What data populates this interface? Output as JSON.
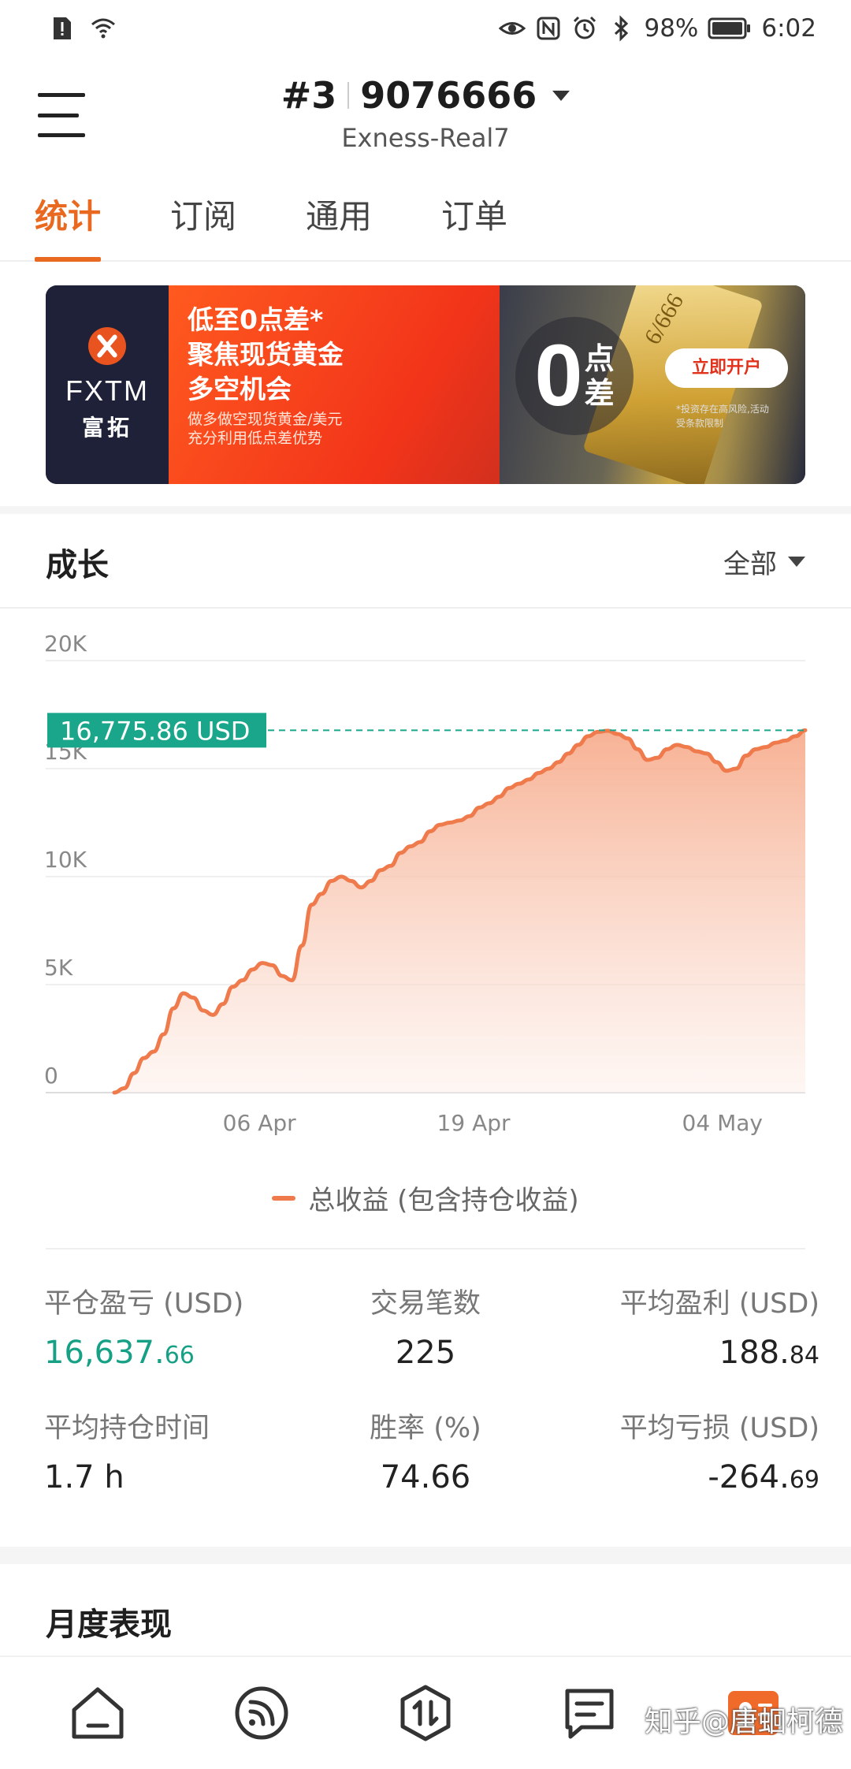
{
  "status_bar": {
    "battery": "98%",
    "time": "6:02"
  },
  "header": {
    "account_prefix": "#3",
    "account_number": "9076666",
    "server": "Exness-Real7"
  },
  "tabs": [
    {
      "label": "统计",
      "active": true
    },
    {
      "label": "订阅",
      "active": false
    },
    {
      "label": "通用",
      "active": false
    },
    {
      "label": "订单",
      "active": false
    }
  ],
  "banner": {
    "brand": "FXTM",
    "brand_cn": "富拓",
    "headline_1": "低至0点差*",
    "headline_2": "聚焦现货黄金",
    "headline_3": "多空机会",
    "sub_1": "做多做空现货黄金/美元",
    "sub_2": "充分利用低点差优势",
    "zero": "0",
    "zero_label_1": "点",
    "zero_label_2": "差",
    "gold_mark": "6/666",
    "cta": "立即开户",
    "disclaimer": "*投资存在高风险,活动受条款限制"
  },
  "growth": {
    "title": "成长",
    "range": "全部"
  },
  "chart_data": {
    "type": "area",
    "y_ticks": [
      "20K",
      "15K",
      "10K",
      "5K",
      "0"
    ],
    "x_ticks": [
      "06 Apr",
      "19 Apr",
      "04 May"
    ],
    "ylim": [
      0,
      20000
    ],
    "current_value_label": "16,775.86 USD",
    "current_value": 16775.86,
    "legend": "总收益 (包含持仓收益)",
    "colors": {
      "line": "#ef7a4c",
      "fill_top": "#f6a989",
      "fill_bottom": "#fdf1ec",
      "marker": "#1aa68a"
    },
    "values": [
      0,
      200,
      900,
      1600,
      1900,
      2700,
      3900,
      4600,
      4400,
      3800,
      3600,
      4100,
      4900,
      5200,
      5700,
      6000,
      5900,
      5400,
      5200,
      6800,
      8700,
      9200,
      9800,
      10000,
      9800,
      9500,
      9800,
      10300,
      10500,
      11100,
      11400,
      11600,
      12100,
      12400,
      12500,
      12600,
      12800,
      13200,
      13400,
      13700,
      14100,
      14300,
      14500,
      14800,
      15000,
      15300,
      15700,
      16100,
      16500,
      16700,
      16750,
      16600,
      16400,
      15900,
      15400,
      15500,
      15900,
      16100,
      16000,
      15800,
      15700,
      15300,
      14900,
      15000,
      15600,
      15900,
      16000,
      16200,
      16300,
      16500,
      16775.86
    ]
  },
  "stats": [
    {
      "label": "平仓盈亏 (USD)",
      "main": "16,637.",
      "decimals": "66",
      "positive": true
    },
    {
      "label": "交易笔数",
      "main": "225",
      "decimals": "",
      "positive": false
    },
    {
      "label": "平均盈利 (USD)",
      "main": "188.",
      "decimals": "84",
      "positive": false
    },
    {
      "label": "平均持仓时间",
      "main": "1.7 h",
      "decimals": "",
      "positive": false
    },
    {
      "label": "胜率 (%)",
      "main": "74.66",
      "decimals": "",
      "positive": false
    },
    {
      "label": "平均亏损 (USD)",
      "main": "-264.",
      "decimals": "69",
      "positive": false
    }
  ],
  "monthly": {
    "title": "月度表现"
  },
  "bottom_nav": {
    "icons": [
      "home-icon",
      "feed-icon",
      "trade-icon",
      "news-icon",
      "profile-icon"
    ]
  },
  "watermark": "知乎@唐蛔柯德"
}
